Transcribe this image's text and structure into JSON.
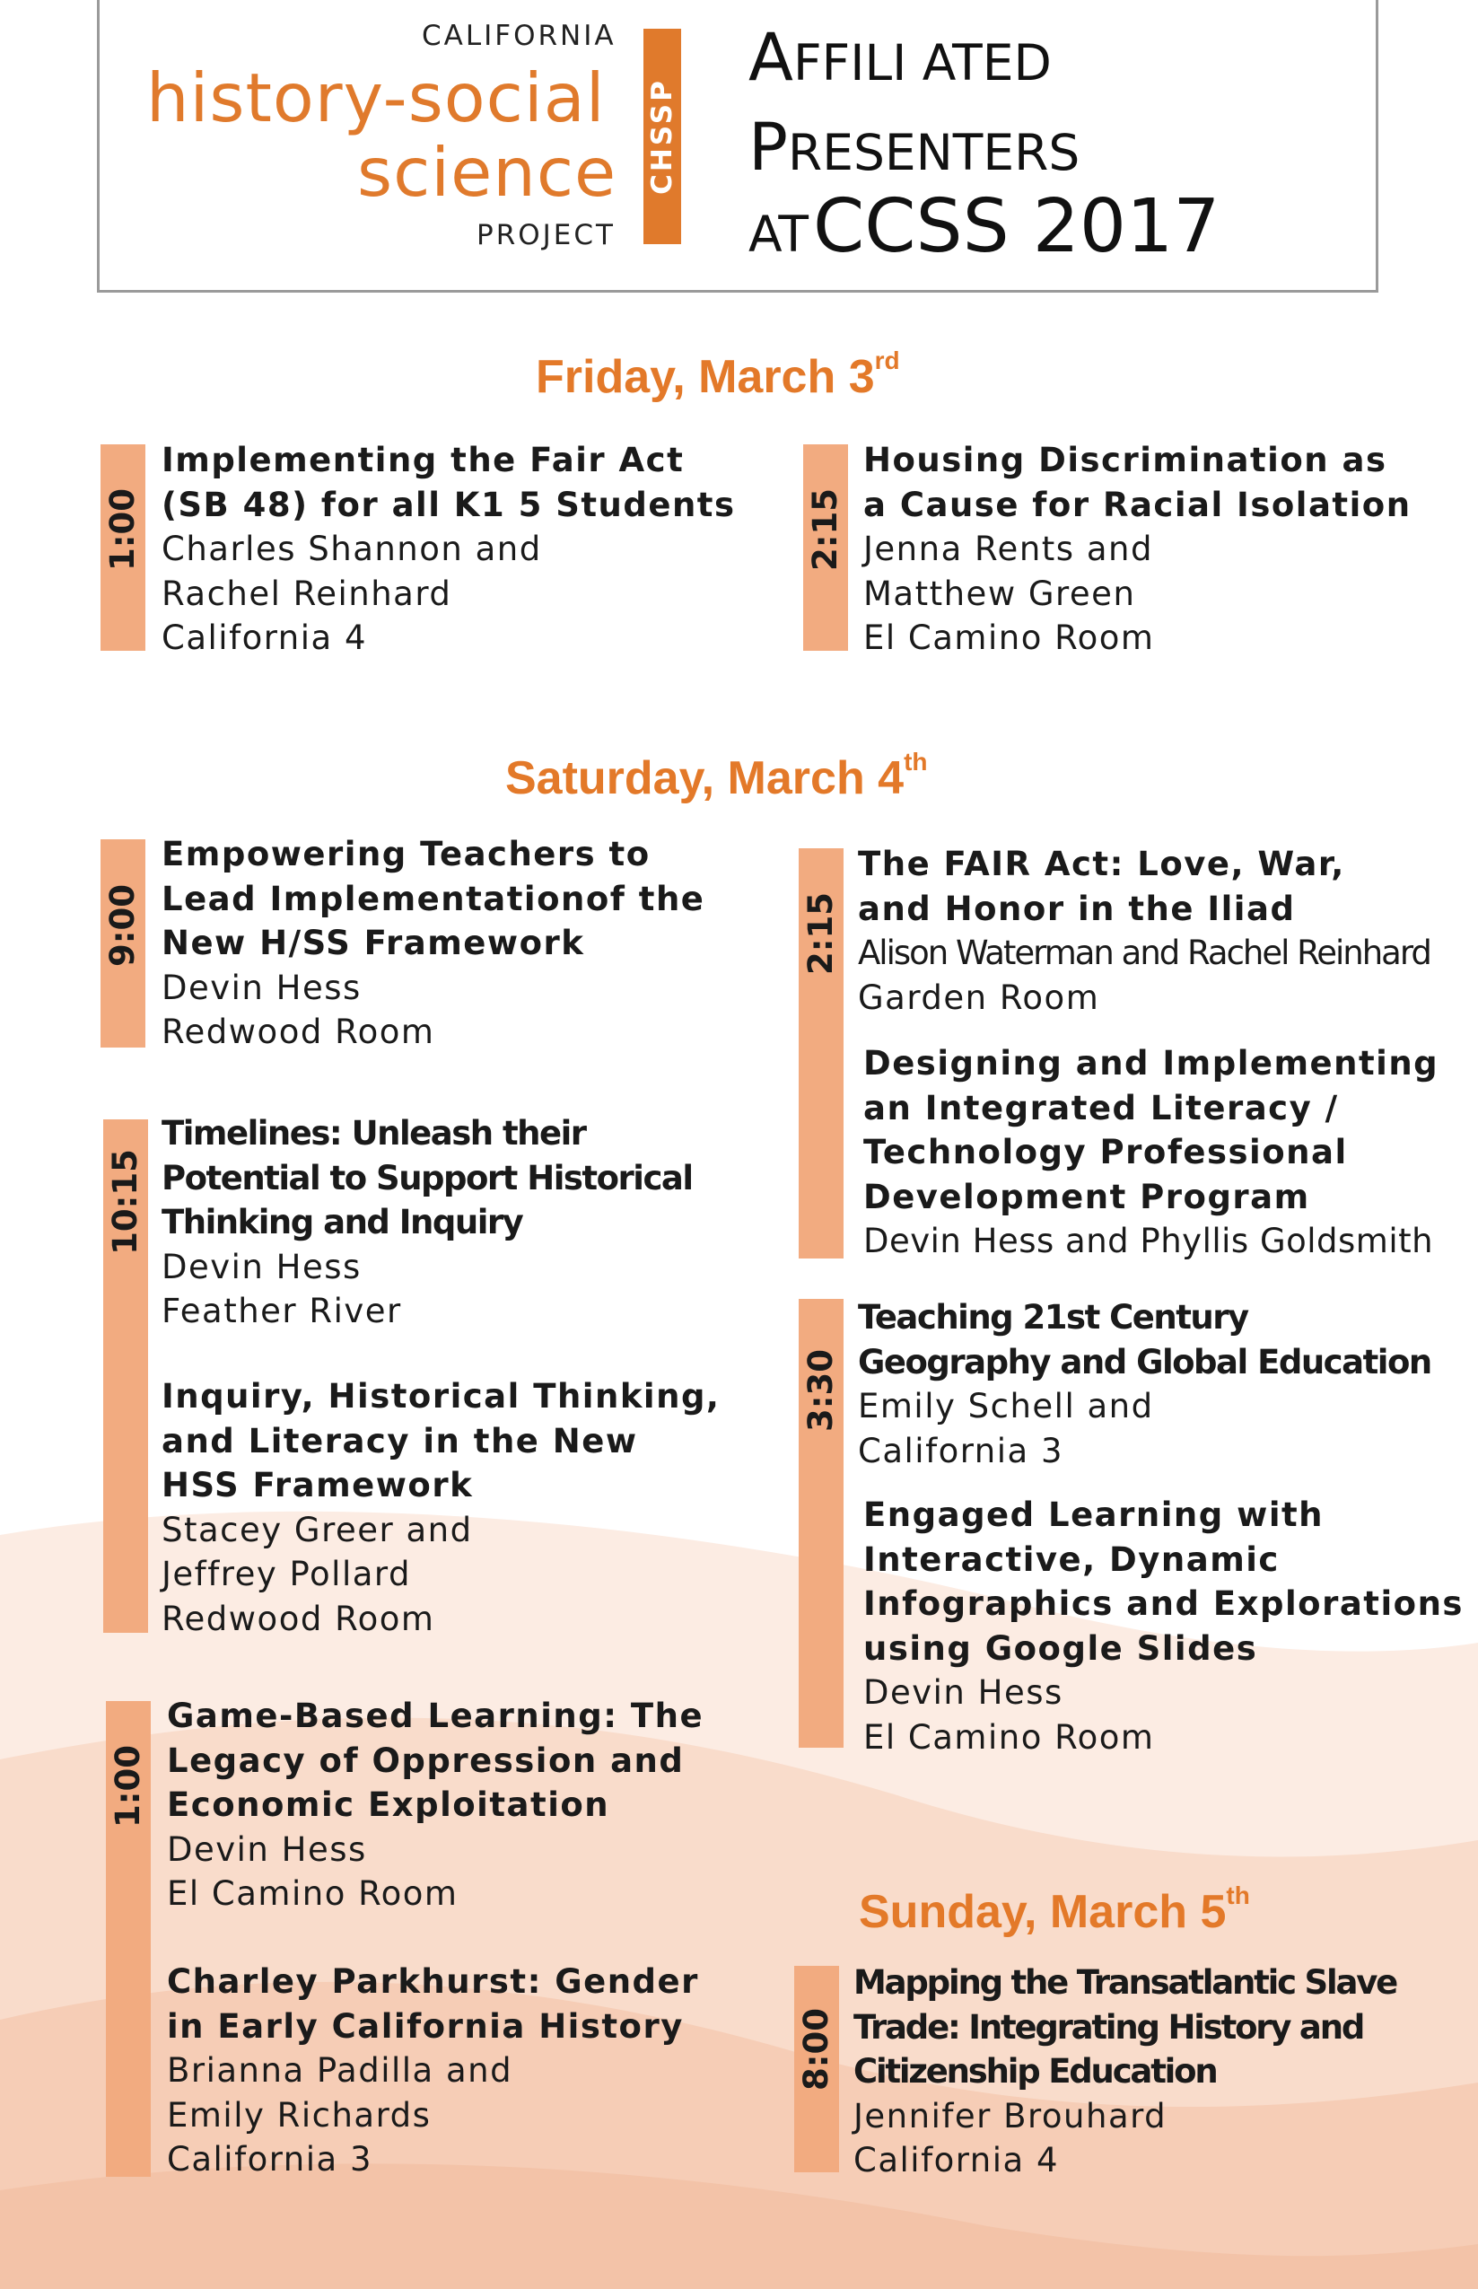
{
  "header": {
    "logo_top": "CALIFORNIA",
    "logo_line1": "history-social",
    "logo_line2": "science",
    "logo_bottom": "PROJECT",
    "logo_tag": "CHSSP",
    "title_line1_cap": "A",
    "title_line1_rest": "FFILI ATED",
    "title_line2_cap": "P",
    "title_line2_rest": "RESENTERS",
    "title_line3_small": "AT",
    "title_line3_big": "CCSS 2017"
  },
  "days": {
    "friday": {
      "label": "Friday, March 3",
      "suffix": "rd"
    },
    "saturday": {
      "label": "Saturday, March 4",
      "suffix": "th"
    },
    "sunday": {
      "label": "Sunday, March 5",
      "suffix": "th"
    }
  },
  "times": {
    "fri_1": "1:00",
    "fri_2": "2:15",
    "sat_9": "9:00",
    "sat_1015": "10:15",
    "sat_100": "1:00",
    "sat_215": "2:15",
    "sat_330": "3:30",
    "sun_8": "8:00"
  },
  "sessions": {
    "fri_a": {
      "title": "Implementing the Fair Act\n(SB 48) for all K1 5 Students",
      "presenters": "Charles Shannon and\nRachel Reinhard",
      "room": "California 4"
    },
    "fri_b": {
      "title": "Housing Discrimination as\na Cause for Racial Isolation",
      "presenters": "Jenna Rents and\nMatthew Green",
      "room": "El Camino Room"
    },
    "sat_a": {
      "title": "Empowering Teachers to\nLead Implementationof the\nNew H/SS Framework",
      "presenters": "Devin Hess",
      "room": "Redwood Room"
    },
    "sat_b": {
      "title": "Timelines: Unleash their\nPotential to Support Historical\nThinking and Inquiry",
      "presenters": "Devin Hess",
      "room": "Feather River"
    },
    "sat_c": {
      "title": "Inquiry, Historical Thinking,\nand Literacy in the New\nHSS Framework",
      "presenters": "Stacey Greer and\nJeffrey Pollard",
      "room": "Redwood Room"
    },
    "sat_d": {
      "title": "Game-Based Learning: The\nLegacy of Oppression and\nEconomic Exploitation",
      "presenters": "Devin Hess",
      "room": "El Camino Room"
    },
    "sat_e": {
      "title": "Charley Parkhurst: Gender\nin Early California History",
      "presenters": "Brianna Padilla and\nEmily Richards",
      "room": "California 3"
    },
    "sat_f": {
      "title": "The FAIR Act: Love, War,\nand Honor in the Iliad",
      "presenters": "Alison Waterman and Rachel Reinhard",
      "room": "Garden Room"
    },
    "sat_g": {
      "title": "Designing and Implementing\nan Integrated Literacy /\nTechnology Professional\nDevelopment Program",
      "presenters": "Devin Hess and Phyllis Goldsmith",
      "room": ""
    },
    "sat_h": {
      "title": "Teaching 21st Century\nGeography and Global Education",
      "presenters": "Emily Schell and",
      "room": "California 3"
    },
    "sat_i": {
      "title": "Engaged Learning with\nInteractive, Dynamic\nInfographics and Explorations\nusing Google Slides",
      "presenters": "Devin Hess",
      "room": "El Camino Room"
    },
    "sun_a": {
      "title": "Mapping the Transatlantic Slave\nTrade: Integrating History and\nCitizenship Education",
      "presenters": "Jennifer Brouhard",
      "room": "California 4"
    }
  },
  "colors": {
    "accent": "#e37929",
    "time_bar": "#f2ab80",
    "wave_light": "#fbe6dc",
    "wave_mid": "#f7d3c0",
    "wave_dark": "#f3c2a8"
  }
}
